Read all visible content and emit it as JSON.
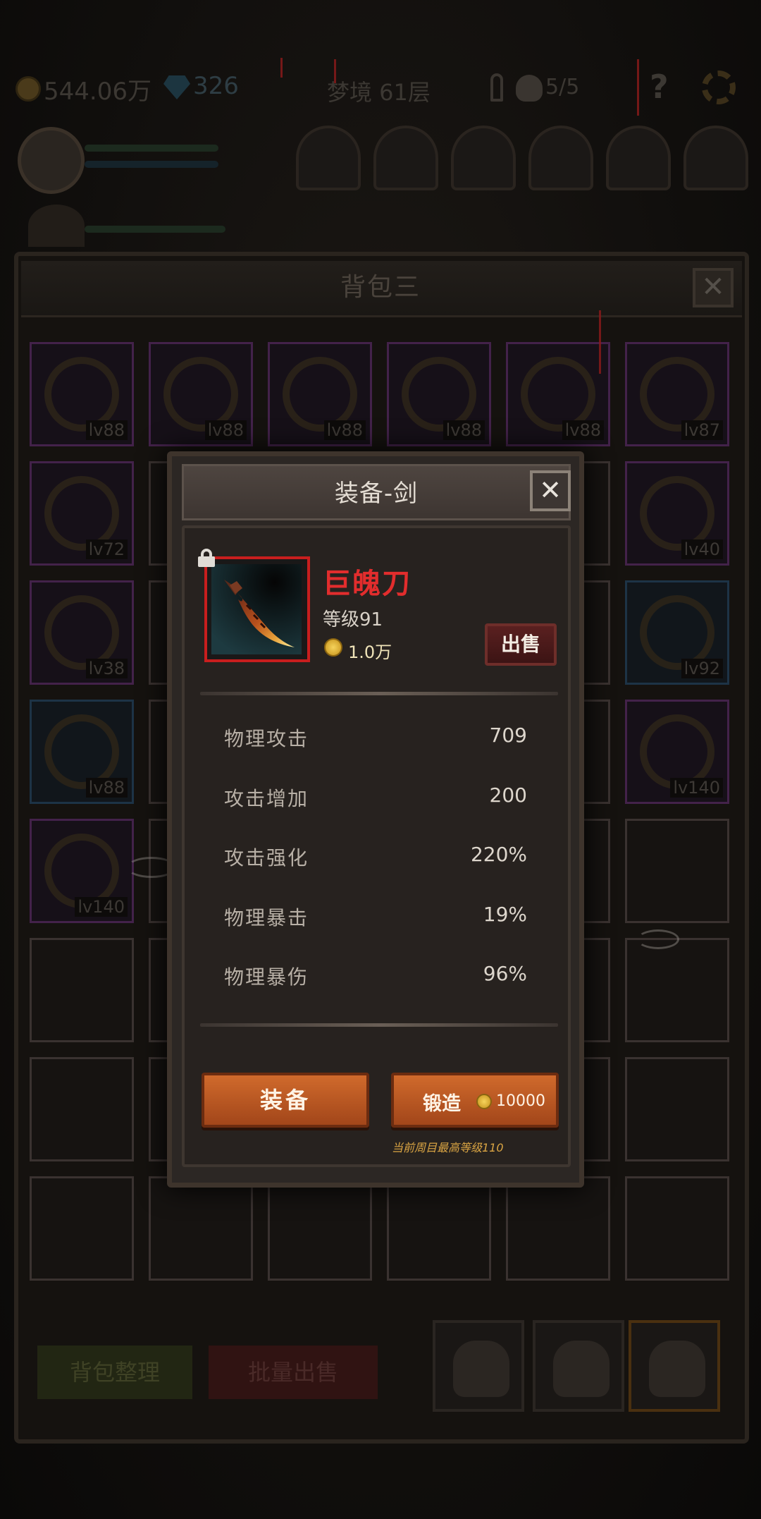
{
  "topbar": {
    "gold": "544.06万",
    "gems": "326",
    "stage": "梦境 61层",
    "keys": "5/5",
    "help": "?"
  },
  "backpack": {
    "title": "背包三",
    "close": "✕",
    "cells": [
      {
        "lv": "lv88",
        "rarity": "purple"
      },
      {
        "lv": "lv88",
        "rarity": "purple"
      },
      {
        "lv": "lv88",
        "rarity": "purple"
      },
      {
        "lv": "lv88",
        "rarity": "purple"
      },
      {
        "lv": "lv88",
        "rarity": "purple"
      },
      {
        "lv": "lv87",
        "rarity": "purple"
      },
      {
        "lv": "lv72",
        "rarity": "purple"
      },
      {
        "lv": "lv40",
        "rarity": "purple"
      },
      {
        "lv": "lv38",
        "rarity": "purple"
      },
      {
        "lv": "lv92",
        "rarity": "blue"
      },
      {
        "lv": "lv88",
        "rarity": "blue"
      },
      {
        "lv": "lv140",
        "rarity": "purple"
      },
      {
        "lv": "lv140",
        "rarity": "purple"
      }
    ],
    "sort_button": "背包整理",
    "bulk_sell_button": "批量出售"
  },
  "dialog": {
    "title": "装备-剑",
    "close": "✕",
    "item": {
      "name": "巨魄刀",
      "level": "等级91",
      "price": "1.0万",
      "sell": "出售"
    },
    "stats": [
      {
        "name": "物理攻击",
        "value": "709"
      },
      {
        "name": "攻击增加",
        "value": "200"
      },
      {
        "name": "攻击强化",
        "value": "220%"
      },
      {
        "name": "物理暴击",
        "value": "19%"
      },
      {
        "name": "物理暴伤",
        "value": "96%"
      }
    ],
    "equip_button": "装备",
    "forge_button": "锻造",
    "forge_cost": "10000",
    "hint": "当前周目最高等级110"
  },
  "colors": {
    "item_name": "#e22d2d",
    "button_orange": "#c2602a",
    "hint": "#d9a443"
  },
  "icons": [
    "coin-icon",
    "gem-icon",
    "key-icon",
    "skull-icon",
    "help-icon",
    "settings-icon",
    "lock-icon",
    "sword-icon",
    "close-icon"
  ]
}
